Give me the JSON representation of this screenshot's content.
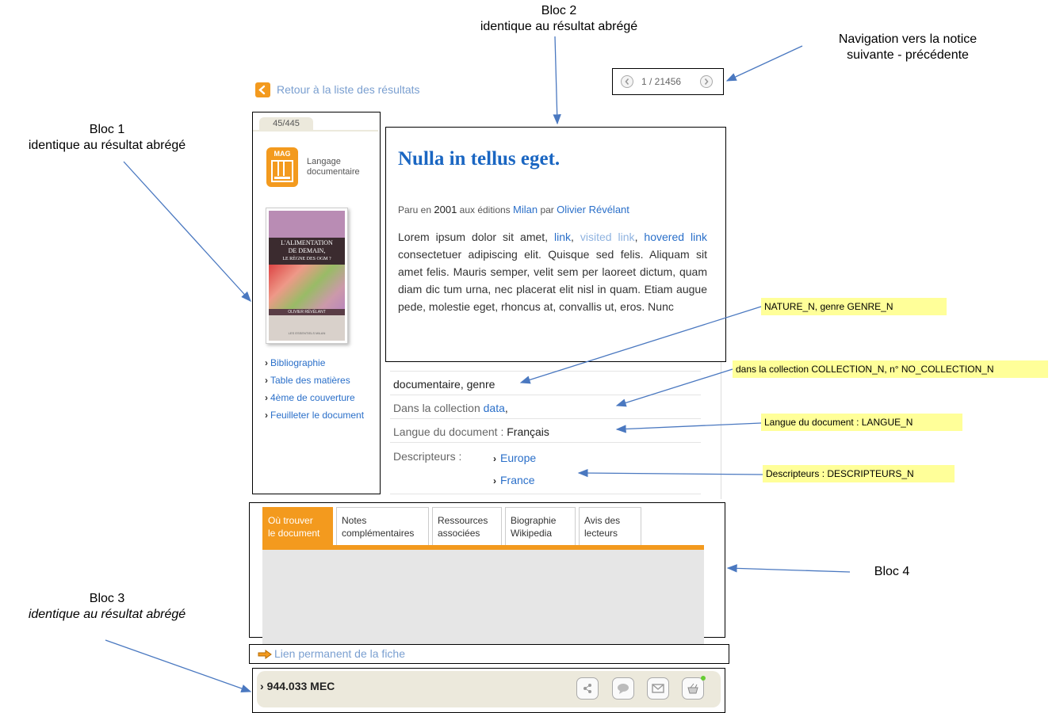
{
  "annotations": {
    "bloc2_title": "Bloc 2",
    "bloc2_sub": "identique au résultat abrégé",
    "nav_title": "Navigation vers la notice",
    "nav_sub": "suivante - précédente",
    "bloc1_title": "Bloc 1",
    "bloc1_sub": "identique au résultat abrégé",
    "bloc3_title": "Bloc 3",
    "bloc3_sub": "identique au résultat abrégé",
    "bloc4_title": "Bloc 4"
  },
  "notes": {
    "nature": "NATURE_N, genre GENRE_N",
    "collection": "dans la collection COLLECTION_N, n° NO_COLLECTION_N",
    "langue": "Langue du document : LANGUE_N",
    "descripteurs": "Descripteurs : DESCRIPTEURS_N"
  },
  "back_link": "Retour à  la liste des résultats",
  "pager": {
    "text": "1 / 21456"
  },
  "sidebar": {
    "counter": "45/445",
    "doc_type_badge": "MAG",
    "doc_type_line1": "Langage",
    "doc_type_line2": "documentaire",
    "cover": {
      "line1": "L'ALIMENTATION",
      "line2": "DE DEMAIN,",
      "line3": "LE RÈGNE DES OGM ?",
      "author": "OLIVIER RÉVÉLANT",
      "series": "LES ESSENTIELS MILAN"
    },
    "links": [
      "Bibliographie",
      "Table des matières",
      "4ème de couverture",
      "Feuilleter le document"
    ]
  },
  "record": {
    "title": "Nulla in tellus eget.",
    "pub_prefix": "Paru en",
    "year": "2001",
    "pub_mid": "aux éditions",
    "publisher": "Milan",
    "pub_by": "par",
    "author": "Olivier Révélant",
    "body_start": "Lorem ipsum dolor sit amet,",
    "link": "link",
    "comma1": ",",
    "visited_link": "visited link",
    "comma2": ",",
    "hovered_link": "hovered link",
    "body_rest": "consectetuer adipiscing elit. Quisque sed felis. Aliquam sit amet felis. Mauris semper, velit sem per laoreet dictum, quam diam dic tum urna, nec placerat elit nisl in quam. Etiam augue pede, molestie eget, rhoncus at, convallis ut, eros. Nunc"
  },
  "fields": {
    "nature": "documentaire, genre",
    "collection_label": "Dans la collection",
    "collection_value": "data",
    "collection_suffix": ",",
    "langue_label": "Langue du document :",
    "langue_value": "Français",
    "descripteurs_label": "Descripteurs :",
    "descripteurs": [
      "Europe",
      "France"
    ]
  },
  "tabs": [
    {
      "line1": "Où trouver",
      "line2": "le document"
    },
    {
      "line1": "Notes",
      "line2": "complémentaires"
    },
    {
      "line1": "Ressources",
      "line2": "associées"
    },
    {
      "line1": "Biographie",
      "line2": "Wikipedia"
    },
    {
      "line1": "Avis des",
      "line2": "lecteurs"
    }
  ],
  "permalink": "Lien permanent de la fiche",
  "footer": {
    "call_number": "944.033 MEC",
    "icons": [
      "share-icon",
      "comment-icon",
      "mail-icon",
      "basket-icon"
    ]
  },
  "colors": {
    "accent": "#f39a1e",
    "link": "#2a6fc9",
    "title": "#1a66c2",
    "arrow": "#4a78c0",
    "note_bg": "#ffff99"
  }
}
